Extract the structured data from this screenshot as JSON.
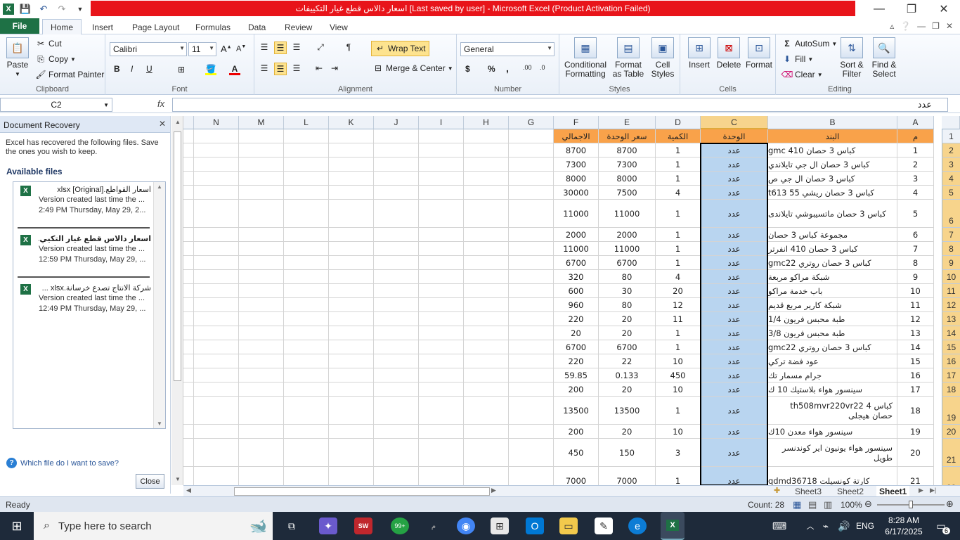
{
  "window": {
    "title": "اسعار دالاس قطع غيار التكييفات [Last saved by user]  -  Microsoft Excel (Product Activation Failed)"
  },
  "tabs": [
    "File",
    "Home",
    "Insert",
    "Page Layout",
    "Formulas",
    "Data",
    "Review",
    "View"
  ],
  "ribbon": {
    "clipboard": {
      "paste": "Paste",
      "cut": "Cut",
      "copy": "Copy",
      "format_painter": "Format Painter",
      "label": "Clipboard"
    },
    "font": {
      "name": "Calibri",
      "size": "11",
      "bold": "B",
      "italic": "I",
      "underline": "U",
      "label": "Font"
    },
    "alignment": {
      "wrap": "Wrap Text",
      "merge": "Merge & Center",
      "label": "Alignment"
    },
    "number": {
      "format": "General",
      "currency": "$",
      "percent": "%",
      "comma": ",",
      "label": "Number"
    },
    "styles": {
      "conditional": "Conditional",
      "conditional2": "Formatting",
      "format_table": "Format",
      "format_table2": "as Table",
      "cell_styles": "Cell",
      "cell_styles2": "Styles",
      "label": "Styles"
    },
    "cells": {
      "insert": "Insert",
      "delete": "Delete",
      "format": "Format",
      "label": "Cells"
    },
    "editing": {
      "autosum": "AutoSum",
      "fill": "Fill",
      "clear": "Clear",
      "sort": "Sort &",
      "sort2": "Filter",
      "find": "Find &",
      "find2": "Select",
      "label": "Editing"
    }
  },
  "formula_bar": {
    "name_box": "C2",
    "fx": "fx",
    "value": "عدد"
  },
  "recovery": {
    "title": "Document Recovery",
    "description": "Excel has recovered the following files.  Save the ones you wish to keep.",
    "available": "Available files",
    "files": [
      {
        "name": "اسعار القواطع.xlsx  [Original]",
        "line2": "Version created last time the ...",
        "line3": "2:49 PM Thursday, May 29, 2..."
      },
      {
        "name": "اسعار دالاس قطع غيار التكيي...",
        "line2": "Version created last time the ...",
        "line3": "12:59 PM Thursday, May 29, ..."
      },
      {
        "name": "شركة الانتاج تصدع خرسانة.xlsx ...",
        "line2": "Version created last time the ...",
        "line3": "12:49 PM Thursday, May 29, ..."
      }
    ],
    "help": "Which file do I want to save?",
    "close": "Close"
  },
  "columns": [
    "N",
    "M",
    "L",
    "K",
    "J",
    "I",
    "H",
    "G",
    "F",
    "E",
    "D",
    "C",
    "B",
    "A"
  ],
  "sheet": {
    "header": {
      "a": "م",
      "b": "البند",
      "c": "الوحدة",
      "d": "الكمية",
      "e": "سعر الوحدة",
      "f": "الاجمالي"
    },
    "rows": [
      {
        "r": "2",
        "a": "1",
        "b": "كباس 3 حصان 410 gmc",
        "c": "عدد",
        "d": "1",
        "e": "8700",
        "f": "8700"
      },
      {
        "r": "3",
        "a": "2",
        "b": "كباس 3 حصان ال جي تايلاندي",
        "c": "عدد",
        "d": "1",
        "e": "7300",
        "f": "7300"
      },
      {
        "r": "4",
        "a": "3",
        "b": "كباس 3 حصان ال جي ص",
        "c": "عدد",
        "d": "1",
        "e": "8000",
        "f": "8000"
      },
      {
        "r": "5",
        "a": "4",
        "b": "كباس 3 حصان ريشي 55 t613",
        "c": "عدد",
        "d": "4",
        "e": "7500",
        "f": "30000"
      },
      {
        "r": "6",
        "a": "5",
        "b": "كباس 3 حصان ماتسيبوشي تايلاندى",
        "c": "عدد",
        "d": "1",
        "e": "11000",
        "f": "11000"
      },
      {
        "r": "7",
        "a": "6",
        "b": "مجموعة كباس 3 حصان",
        "c": "عدد",
        "d": "1",
        "e": "2000",
        "f": "2000"
      },
      {
        "r": "8",
        "a": "7",
        "b": "كباس 3 حصان 410 انفرتر",
        "c": "عدد",
        "d": "1",
        "e": "11000",
        "f": "11000"
      },
      {
        "r": "9",
        "a": "8",
        "b": "كباس 3 حصان روتري gmc22",
        "c": "عدد",
        "d": "1",
        "e": "6700",
        "f": "6700"
      },
      {
        "r": "10",
        "a": "9",
        "b": "شبكة مراكو مربعة",
        "c": "عدد",
        "d": "4",
        "e": "80",
        "f": "320"
      },
      {
        "r": "11",
        "a": "10",
        "b": "باب خدمة مراكو",
        "c": "عدد",
        "d": "20",
        "e": "30",
        "f": "600"
      },
      {
        "r": "12",
        "a": "11",
        "b": "شبكة كارير مربع قديم",
        "c": "عدد",
        "d": "12",
        "e": "80",
        "f": "960"
      },
      {
        "r": "13",
        "a": "12",
        "b": "طبة محبس فريون 1/4",
        "c": "عدد",
        "d": "11",
        "e": "20",
        "f": "220"
      },
      {
        "r": "14",
        "a": "13",
        "b": "طبة محبس فريون 3/8",
        "c": "عدد",
        "d": "1",
        "e": "20",
        "f": "20"
      },
      {
        "r": "15",
        "a": "14",
        "b": "كباس 3 حصان روتري gmc22",
        "c": "عدد",
        "d": "1",
        "e": "6700",
        "f": "6700"
      },
      {
        "r": "16",
        "a": "15",
        "b": "عود فضة تركي",
        "c": "عدد",
        "d": "10",
        "e": "22",
        "f": "220"
      },
      {
        "r": "17",
        "a": "16",
        "b": "جرام مسمار تك",
        "c": "عدد",
        "d": "450",
        "e": "0.133",
        "f": "59.85"
      },
      {
        "r": "18",
        "a": "17",
        "b": "سينسور هواء بلاستيك 10 ك",
        "c": "عدد",
        "d": "10",
        "e": "20",
        "f": "200"
      },
      {
        "r": "19",
        "a": "18",
        "b": "كباس 4 th508mvr220vr22 حصان هيجلى",
        "c": "عدد",
        "d": "1",
        "e": "13500",
        "f": "13500"
      },
      {
        "r": "20",
        "a": "19",
        "b": "سينسور هواء معدن 10ك",
        "c": "عدد",
        "d": "10",
        "e": "20",
        "f": "200"
      },
      {
        "r": "21",
        "a": "20",
        "b": "سينسور هواء يونيون اير كوندنسر طويل",
        "c": "عدد",
        "d": "3",
        "e": "150",
        "f": "450"
      },
      {
        "r": "22",
        "a": "21",
        "b": "كارتة كونسيلت qdmd36718",
        "c": "عدد",
        "d": "1",
        "e": "7000",
        "f": "7000"
      }
    ]
  },
  "sheet_tabs": [
    "Sheet3",
    "Sheet2",
    "Sheet1"
  ],
  "status": {
    "ready": "Ready",
    "count": "Count: 28",
    "zoom": "100%"
  },
  "taskbar": {
    "search_placeholder": "Type here to search",
    "badge": "99+",
    "lang": "ENG",
    "time": "8:28 AM",
    "date": "6/17/2025",
    "notifications": "6"
  }
}
